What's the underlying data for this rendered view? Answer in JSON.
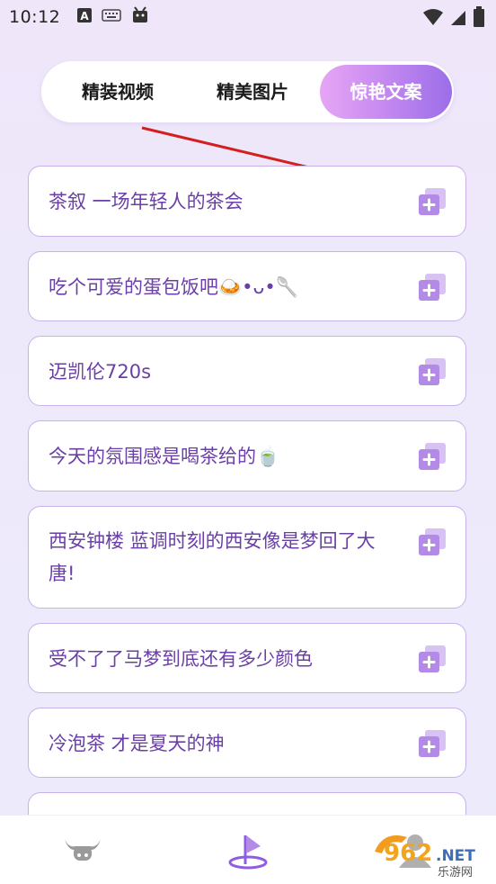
{
  "status_bar": {
    "time": "10:12",
    "icons": [
      "a-icon",
      "keyboard-icon",
      "android-icon",
      "wifi-icon",
      "signal-icon",
      "battery-icon"
    ]
  },
  "tabs": [
    {
      "label": "精装视频",
      "active": false
    },
    {
      "label": "精美图片",
      "active": false
    },
    {
      "label": "惊艳文案",
      "active": true
    }
  ],
  "cards": [
    {
      "text": "茶叙  一场年轻人的茶会"
    },
    {
      "text": "吃个可爱的蛋包饭吧🍛•ᴗ•🥄"
    },
    {
      "text": "迈凯伦720s"
    },
    {
      "text": "今天的氛围感是喝茶给的🍵"
    },
    {
      "text": "西安钟楼 蓝调时刻的西安像是梦回了大唐!"
    },
    {
      "text": "受不了了马梦到底还有多少颜色"
    },
    {
      "text": "冷泡茶 才是夏天的神"
    },
    {
      "text": ""
    }
  ],
  "bottom_nav": {
    "items": [
      "bull-icon",
      "app-logo-icon",
      "profile-icon"
    ]
  },
  "watermark": {
    "text": "962.NET",
    "subtext": "乐游网"
  },
  "colors": {
    "accent_start": "#e6a6f4",
    "accent_end": "#9b6ee8",
    "text_purple": "#6a3fa6",
    "card_border": "#c7b3ea",
    "icon_purple": "#b38be6",
    "arrow_red": "#d41f1f"
  }
}
